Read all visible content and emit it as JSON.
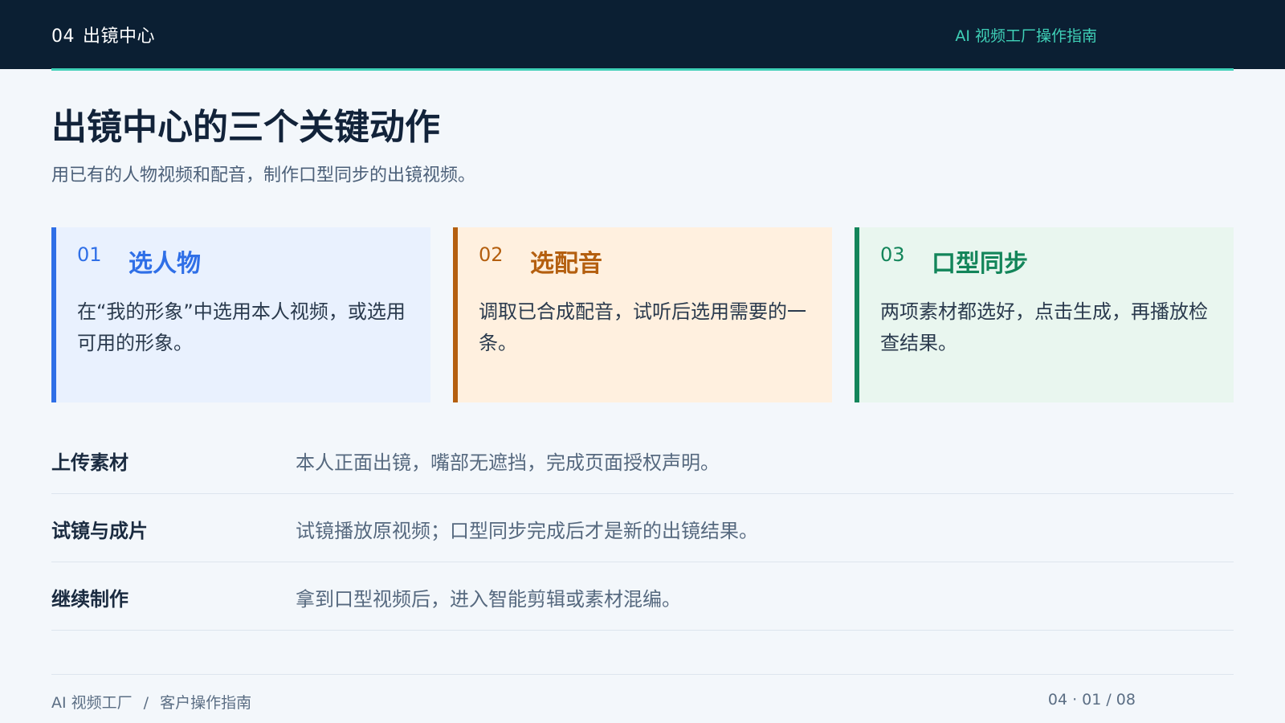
{
  "header": {
    "section_number": "04",
    "section_title": "出镜中心",
    "doc_title": "AI 视频工厂操作指南"
  },
  "colors": {
    "header_bg": "#0b1f33",
    "accent_teal": "#3fd0b7",
    "step1_blue": "#2f6fe7",
    "step2_orange": "#b45f0f",
    "step3_green": "#13855a"
  },
  "main": {
    "title": "出镜中心的三个关键动作",
    "subtitle": "用已有的人物视频和配音，制作口型同步的出镜视频。",
    "steps": [
      {
        "number": "01",
        "title": "选人物",
        "description": "在“我的形象”中选用本人视频，或选用可用的形象。"
      },
      {
        "number": "02",
        "title": "选配音",
        "description": "调取已合成配音，试听后选用需要的一条。"
      },
      {
        "number": "03",
        "title": "口型同步",
        "description": "两项素材都选好，点击生成，再播放检查结果。"
      }
    ],
    "notes": [
      {
        "label": "上传素材",
        "text": "本人正面出镜，嘴部无遮挡，完成页面授权声明。"
      },
      {
        "label": "试镜与成片",
        "text": "试镜播放原视频；口型同步完成后才是新的出镜结果。"
      },
      {
        "label": "继续制作",
        "text": "拿到口型视频后，进入智能剪辑或素材混编。"
      }
    ]
  },
  "footer": {
    "brand": "AI 视频工厂",
    "separator": "/",
    "section": "客户操作指南",
    "page": "04 · 01 / 08"
  }
}
